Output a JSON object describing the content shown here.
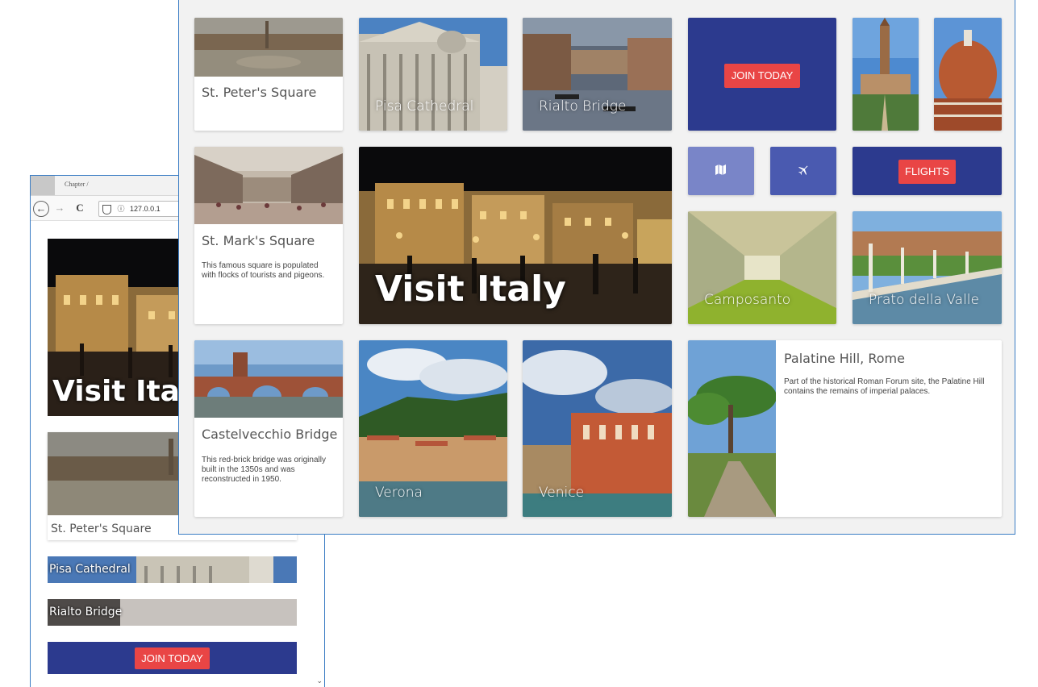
{
  "back_window": {
    "tab_title": "Chapter /",
    "nav": {
      "back_icon": "←",
      "forward_icon": "→",
      "reload_icon": "C"
    },
    "url": "127.0.0.1",
    "url_prefix_icons": "ⓘ",
    "hero_title": "Visit Italy",
    "card_st_peters": "St. Peter's Square",
    "card_pisa": "Pisa Cathedral",
    "card_rialto": "Rialto Bridge",
    "join_button": "JOIN TODAY"
  },
  "front_window": {
    "cards": {
      "st_peters": {
        "title": "St. Peter's Square"
      },
      "pisa": {
        "title": "Pisa Cathedral"
      },
      "rialto": {
        "title": "Rialto Bridge"
      },
      "join": {
        "button": "JOIN TODAY"
      },
      "st_marks": {
        "title": "St. Mark's Square",
        "description": "This famous square is populated with flocks of tourists and pigeons."
      },
      "hero": {
        "title": "Visit Italy"
      },
      "flights": {
        "button": "FLIGHTS"
      },
      "camposanto": {
        "title": "Camposanto"
      },
      "prato": {
        "title": "Prato della Valle"
      },
      "castelvecchio": {
        "title": "Castelvecchio Bridge",
        "description": "This red-brick bridge was originally built in the 1350s and was reconstructed in 1950."
      },
      "verona": {
        "title": "Verona"
      },
      "venice": {
        "title": "Venice"
      },
      "palatine": {
        "title": "Palatine Hill, Rome",
        "description": "Part of the historical Roman Forum site, the Palatine Hill contains the remains of imperial palaces."
      }
    },
    "icons": {
      "map": "map-icon",
      "flight": "airplane-icon"
    }
  },
  "colors": {
    "primary": "#2c3a8e",
    "primary_light": "#7985c8",
    "accent": "#e94545",
    "window_border": "#3b7dc4",
    "background": "#f2f2f2"
  }
}
